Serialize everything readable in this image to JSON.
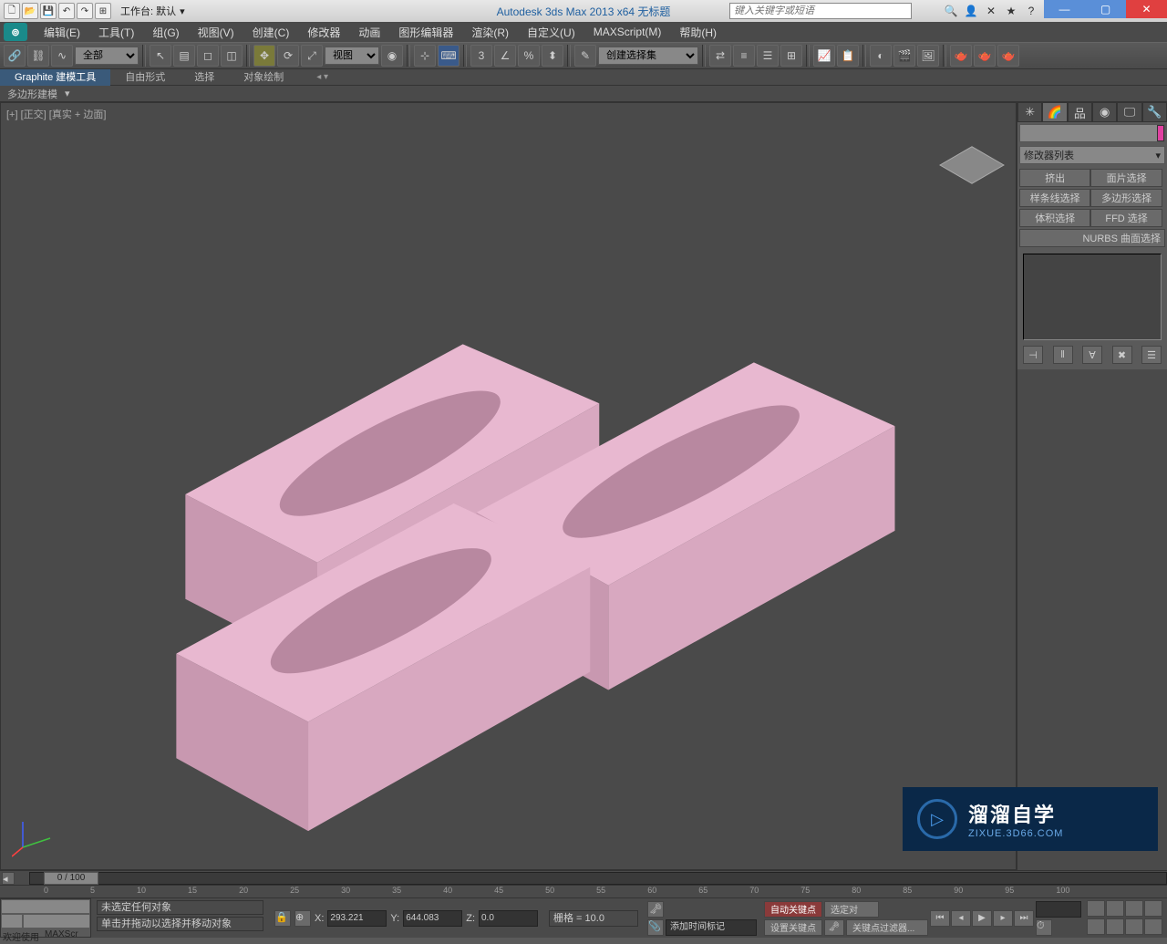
{
  "titlebar": {
    "workspace_label": "工作台: 默认",
    "app_title": "Autodesk 3ds Max  2013 x64     无标题",
    "search_placeholder": "键入关键字或短语"
  },
  "menu": {
    "edit": "编辑(E)",
    "tools": "工具(T)",
    "group": "组(G)",
    "views": "视图(V)",
    "create": "创建(C)",
    "modifiers": "修改器",
    "animation": "动画",
    "graph": "图形编辑器",
    "render": "渲染(R)",
    "customize": "自定义(U)",
    "maxscript": "MAXScript(M)",
    "help": "帮助(H)"
  },
  "toolbar": {
    "filter_all": "全部",
    "view_combo": "视图",
    "create_set_placeholder": "创建选择集"
  },
  "ribbon": {
    "tab1": "Graphite 建模工具",
    "tab2": "自由形式",
    "tab3": "选择",
    "tab4": "对象绘制",
    "sub": "多边形建模"
  },
  "viewport": {
    "label": "[+] [正交] [真实 + 边面]"
  },
  "cmd": {
    "modifier_list": "修改器列表",
    "btns": {
      "extrude": "挤出",
      "face_sel": "面片选择",
      "spline_sel": "样条线选择",
      "poly_sel": "多边形选择",
      "vol_sel": "体积选择",
      "ffd_sel": "FFD 选择",
      "nurbs": "NURBS 曲面选择"
    }
  },
  "timeline": {
    "slider": "0 / 100",
    "ticks": [
      "0",
      "5",
      "10",
      "15",
      "20",
      "25",
      "30",
      "35",
      "40",
      "45",
      "50",
      "55",
      "60",
      "65",
      "70",
      "75",
      "80",
      "85",
      "90",
      "95",
      "100"
    ]
  },
  "status": {
    "welcome": "欢迎使用",
    "maxscr": "MAXScr",
    "prompt1": "未选定任何对象",
    "prompt2": "单击并拖动以选择并移动对象",
    "x_label": "X:",
    "x_val": "293.221",
    "y_label": "Y:",
    "y_val": "644.083",
    "z_label": "Z:",
    "z_val": "0.0",
    "grid": "栅格 = 10.0",
    "add_time_tag": "添加时间标记",
    "auto_key": "自动关键点",
    "set_key": "设置关键点",
    "sel_target": "选定对",
    "key_filter": "关键点过滤器..."
  },
  "watermark": {
    "text": "溜溜自学",
    "url": "ZIXUE.3D66.COM"
  }
}
